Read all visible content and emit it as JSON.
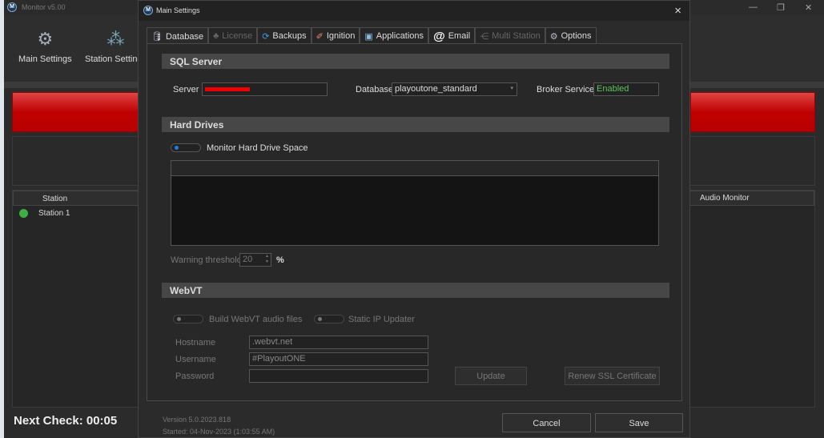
{
  "main_window": {
    "title": "Monitor v5.00",
    "toolbar": [
      {
        "label": "Main Settings",
        "icon": "gear-icon"
      },
      {
        "label": "Station Settings",
        "icon": "gears-icon"
      }
    ],
    "table": {
      "columns": [
        "Station",
        "Audio Monitor"
      ],
      "rows": [
        {
          "name": "Station 1",
          "status_color": "#3cb043"
        }
      ]
    },
    "next_check": "Next Check: 00:05"
  },
  "dialog": {
    "title": "Main Settings",
    "close": "×",
    "tabs": [
      {
        "label": "Database",
        "icon": "database-icon",
        "active": true
      },
      {
        "label": "License",
        "icon": "license-icon",
        "disabled": true
      },
      {
        "label": "Backups",
        "icon": "backups-icon"
      },
      {
        "label": "Ignition",
        "icon": "ignition-icon"
      },
      {
        "label": "Applications",
        "icon": "applications-icon"
      },
      {
        "label": "Email",
        "icon": "at-icon"
      },
      {
        "label": "Multi Station",
        "icon": "multi-station-icon",
        "disabled": true
      },
      {
        "label": "Options",
        "icon": "options-icon"
      }
    ],
    "sql": {
      "header": "SQL Server",
      "server_label": "Server",
      "database_label": "Database",
      "database_value": "playoutone_standard",
      "broker_label": "Broker Service",
      "broker_value": "Enabled",
      "broker_color": "#5cc25c"
    },
    "hard_drives": {
      "header": "Hard Drives",
      "monitor_label": "Monitor Hard Drive Space",
      "monitor_on": true,
      "warning_label": "Warning threshold",
      "warning_value": "20",
      "unit": "%"
    },
    "webvt": {
      "header": "WebVT",
      "build_label": "Build WebVT audio files",
      "static_ip_label": "Static IP Updater",
      "hostname_label": "Hostname",
      "hostname_value": ".webvt.net",
      "username_label": "Username",
      "username_value": "#PlayoutONE",
      "password_label": "Password",
      "password_value": "",
      "update": "Update",
      "renew": "Renew SSL Certificate"
    },
    "footer": {
      "version": "Version 5.0.2023.818",
      "started": "Started: 04-Nov-2023 (1:03:55 AM)",
      "cancel": "Cancel",
      "save": "Save"
    }
  }
}
